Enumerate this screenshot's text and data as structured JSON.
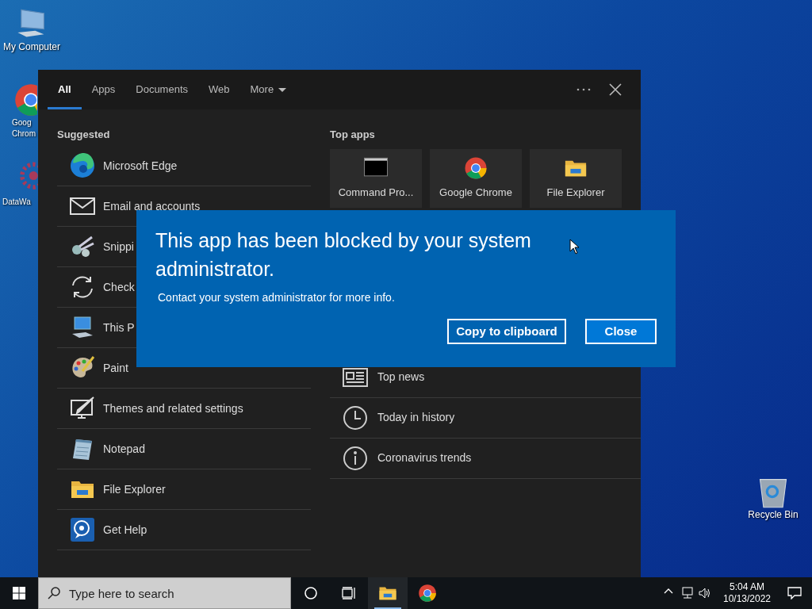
{
  "desktop_icons": [
    {
      "kind": "computer",
      "lines": [
        "My Computer"
      ]
    },
    {
      "kind": "chrome",
      "lines": [
        "Goog",
        "Chrom"
      ]
    },
    {
      "kind": "app",
      "lines": [
        "DataWa"
      ]
    },
    {
      "kind": "recycle",
      "lines": [
        "Recycle Bin"
      ]
    }
  ],
  "search_panel": {
    "tabs": [
      {
        "label": "All",
        "selected": true,
        "dropdown": false
      },
      {
        "label": "Apps",
        "selected": false,
        "dropdown": false
      },
      {
        "label": "Documents",
        "selected": false,
        "dropdown": false
      },
      {
        "label": "Web",
        "selected": false,
        "dropdown": false
      },
      {
        "label": "More",
        "selected": false,
        "dropdown": true
      }
    ],
    "suggested": {
      "heading": "Suggested",
      "items": [
        {
          "kind": "edge",
          "label": "Microsoft Edge"
        },
        {
          "kind": "mail",
          "label": "Email and accounts"
        },
        {
          "kind": "scissors",
          "label": "Snippi"
        },
        {
          "kind": "refresh",
          "label": "Check"
        },
        {
          "kind": "pc",
          "label": "This P"
        },
        {
          "kind": "paint",
          "label": "Paint"
        },
        {
          "kind": "themes",
          "label": "Themes and related settings"
        },
        {
          "kind": "notepad",
          "label": "Notepad"
        },
        {
          "kind": "folder",
          "label": "File Explorer"
        },
        {
          "kind": "help",
          "label": "Get Help"
        }
      ]
    },
    "top_apps": {
      "heading": "Top apps",
      "items": [
        {
          "kind": "terminal",
          "label": "Command Pro..."
        },
        {
          "kind": "chrome",
          "label": "Google Chrome"
        },
        {
          "kind": "folder",
          "label": "File Explorer"
        }
      ]
    },
    "quick_searches": [
      {
        "kind": "news",
        "label": "Top news"
      },
      {
        "kind": "clock",
        "label": "Today in history"
      },
      {
        "kind": "info",
        "label": "Coronavirus trends"
      }
    ]
  },
  "dialog": {
    "title": "This app has been blocked by your system administrator.",
    "message": "Contact your system administrator for more info.",
    "buttons": [
      {
        "label": "Copy to clipboard",
        "kind": "secondary"
      },
      {
        "label": "Close",
        "kind": "primary"
      }
    ]
  },
  "taskbar": {
    "search_placeholder": "Type here to search",
    "apps": [
      {
        "kind": "folder",
        "active": true
      },
      {
        "kind": "chrome",
        "active": false
      }
    ],
    "time": "5:04 AM",
    "date": "10/13/2022"
  }
}
